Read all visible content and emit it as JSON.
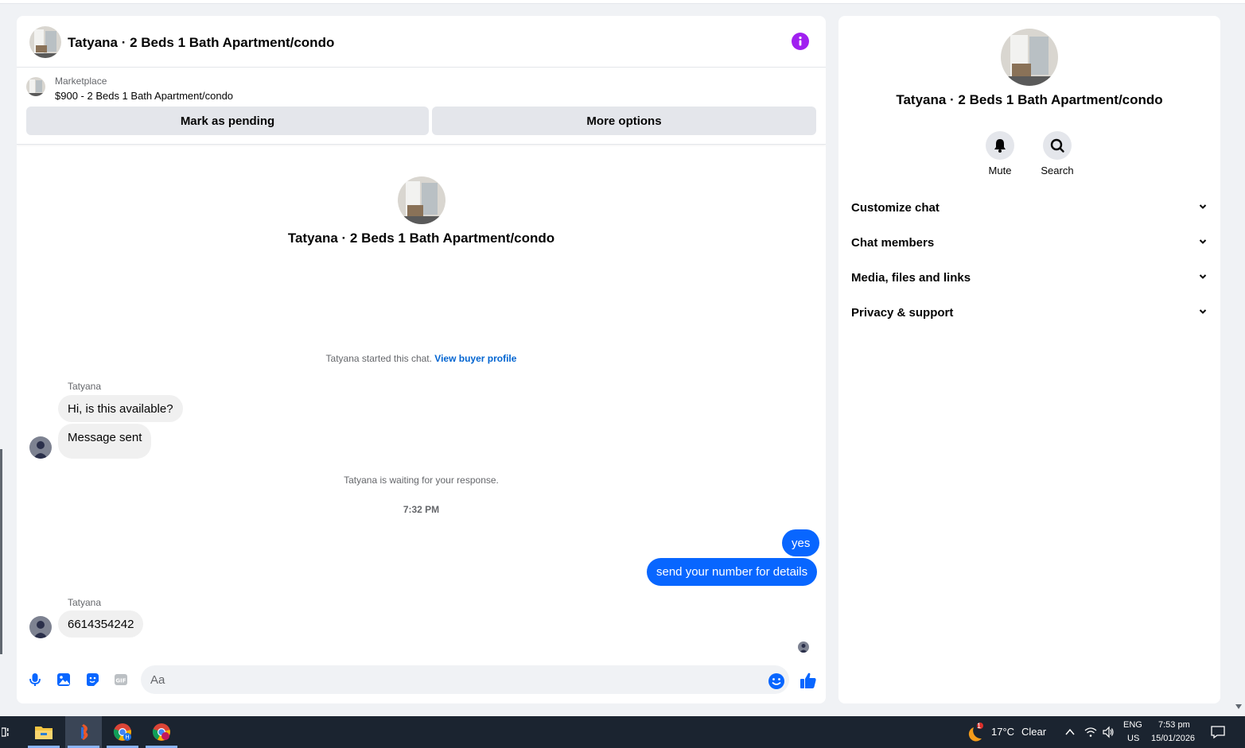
{
  "chat": {
    "title": "Tatyana · 2 Beds 1 Bath Apartment/condo",
    "listing": {
      "label": "Marketplace",
      "price_title": "$900 - 2 Beds 1 Bath Apartment/condo",
      "mark_pending_label": "Mark as pending",
      "more_options_label": "More options"
    },
    "intro_title": "Tatyana · 2 Beds 1 Bath Apartment/condo",
    "started_text": "Tatyana started this chat.",
    "view_buyer_profile": "View buyer profile",
    "messages": [
      {
        "sender": "Tatyana",
        "text": "Hi, is this available?"
      },
      {
        "text": "Message sent"
      },
      {
        "system": "Tatyana is waiting for your response."
      },
      {
        "time": "7:32 PM"
      },
      {
        "outgoing": "yes"
      },
      {
        "outgoing": "send your number for details"
      },
      {
        "sender": "Tatyana",
        "text": "6614354242"
      }
    ],
    "composer_placeholder": "Aa",
    "accent": "#0866ff"
  },
  "info_panel": {
    "title": "Tatyana · 2 Beds 1 Bath Apartment/condo",
    "actions": [
      {
        "label": "Mute",
        "icon": "bell-icon"
      },
      {
        "label": "Search",
        "icon": "search-icon"
      }
    ],
    "sections": [
      "Customize chat",
      "Chat members",
      "Media, files and links",
      "Privacy & support"
    ]
  },
  "taskbar": {
    "weather_temp": "17°C",
    "weather_desc": "Clear",
    "weather_badge": "1",
    "lang_top": "ENG",
    "lang_bottom": "US",
    "time": "7:53 pm",
    "date": "15/01/2026",
    "apps": [
      "file-explorer-icon",
      "powerpoint-icon",
      "chrome-icon",
      "chrome-icon"
    ]
  }
}
